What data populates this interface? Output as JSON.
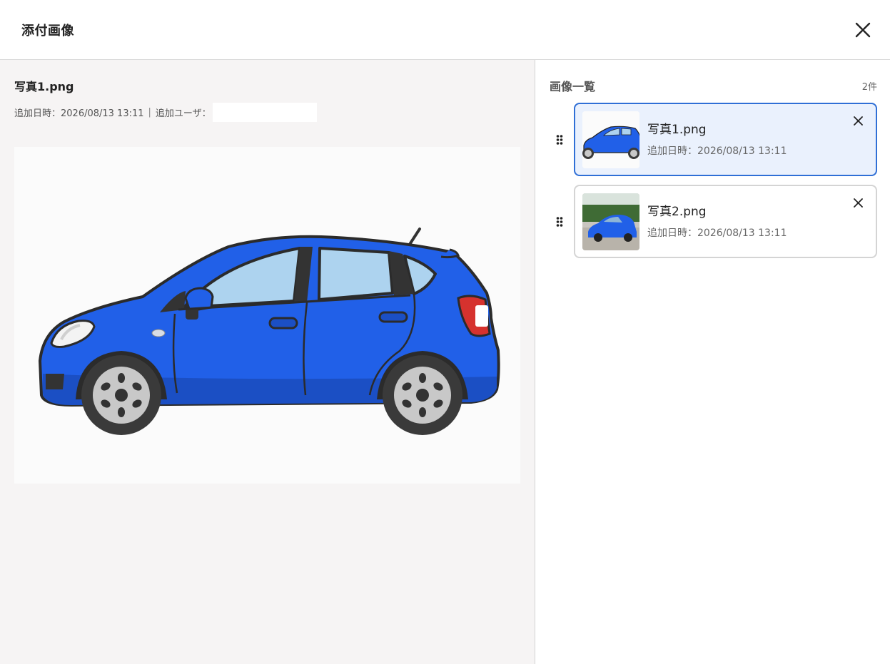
{
  "dialog": {
    "title": "添付画像"
  },
  "detail": {
    "file_name": "写真1.png",
    "added_at_label": "追加日時：2026/08/13 13:11",
    "separator": "|",
    "added_user_label": "追加ユーザ："
  },
  "list": {
    "title": "画像一覧",
    "count": "2件",
    "items": [
      {
        "name": "写真1.png",
        "date": "追加日時：2026/08/13 13:11",
        "selected": true
      },
      {
        "name": "写真2.png",
        "date": "追加日時：2026/08/13 13:11",
        "selected": false
      }
    ]
  },
  "colors": {
    "accent": "#2f6fd6",
    "selected_bg": "#eaf1fd",
    "car_body": "#2160e8"
  },
  "icons": {
    "close": "close-icon",
    "drag": "drag-handle-icon",
    "remove": "remove-icon"
  }
}
